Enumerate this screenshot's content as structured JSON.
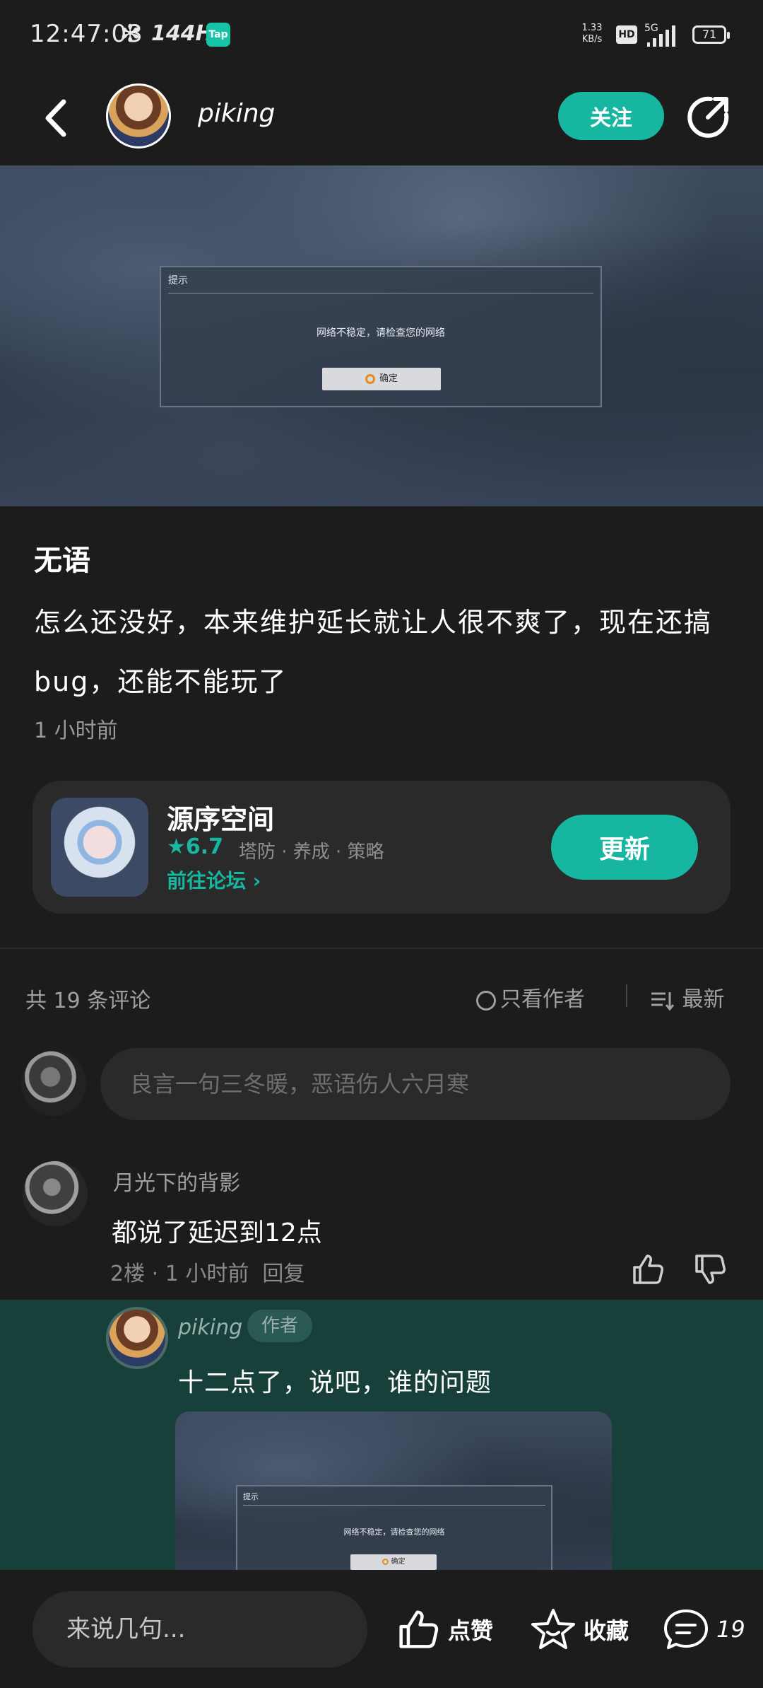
{
  "status_bar": {
    "time": "12:47:03",
    "refresh_rate": "144HZ",
    "app_badge": "Tap",
    "net_speed_value": "1.33",
    "net_speed_unit": "KB/s",
    "hd": "HD",
    "network": "5G",
    "battery": "71"
  },
  "header": {
    "author_name": "piking",
    "follow_label": "关注"
  },
  "post": {
    "image_dialog": {
      "title": "提示",
      "message": "网络不稳定，请检查您的网络",
      "button": "确定"
    },
    "title": "无语",
    "body": "怎么还没好，本来维护延长就让人很不爽了，现在还搞bug，还能不能玩了",
    "time": "1 小时前"
  },
  "game_card": {
    "name": "源序空间",
    "rating": "6.7",
    "tags": "塔防 · 养成 · 策略",
    "forum_link": "前往论坛",
    "update_label": "更新"
  },
  "comments_header": {
    "count_text": "共 19 条评论",
    "only_author": "只看作者",
    "sort": "最新"
  },
  "comment_input": {
    "placeholder": "良言一句三冬暖，恶语伤人六月寒"
  },
  "comments": [
    {
      "user": "月光下的背影",
      "text": "都说了延迟到12点",
      "meta": "2楼 · 1 小时前",
      "reply_label": "回复"
    }
  ],
  "reply": {
    "user": "piking",
    "badge": "作者",
    "text": "十二点了，说吧，谁的问题",
    "image_dialog": {
      "title": "提示",
      "message": "网络不稳定，请检查您的网络",
      "button": "确定"
    }
  },
  "bottom_bar": {
    "input_placeholder": "来说几句...",
    "like_label": "点赞",
    "favorite_label": "收藏",
    "comment_count": "19"
  },
  "colors": {
    "accent": "#16b6a0",
    "background": "#1c1c1c",
    "reply_highlight": "#17403b"
  }
}
